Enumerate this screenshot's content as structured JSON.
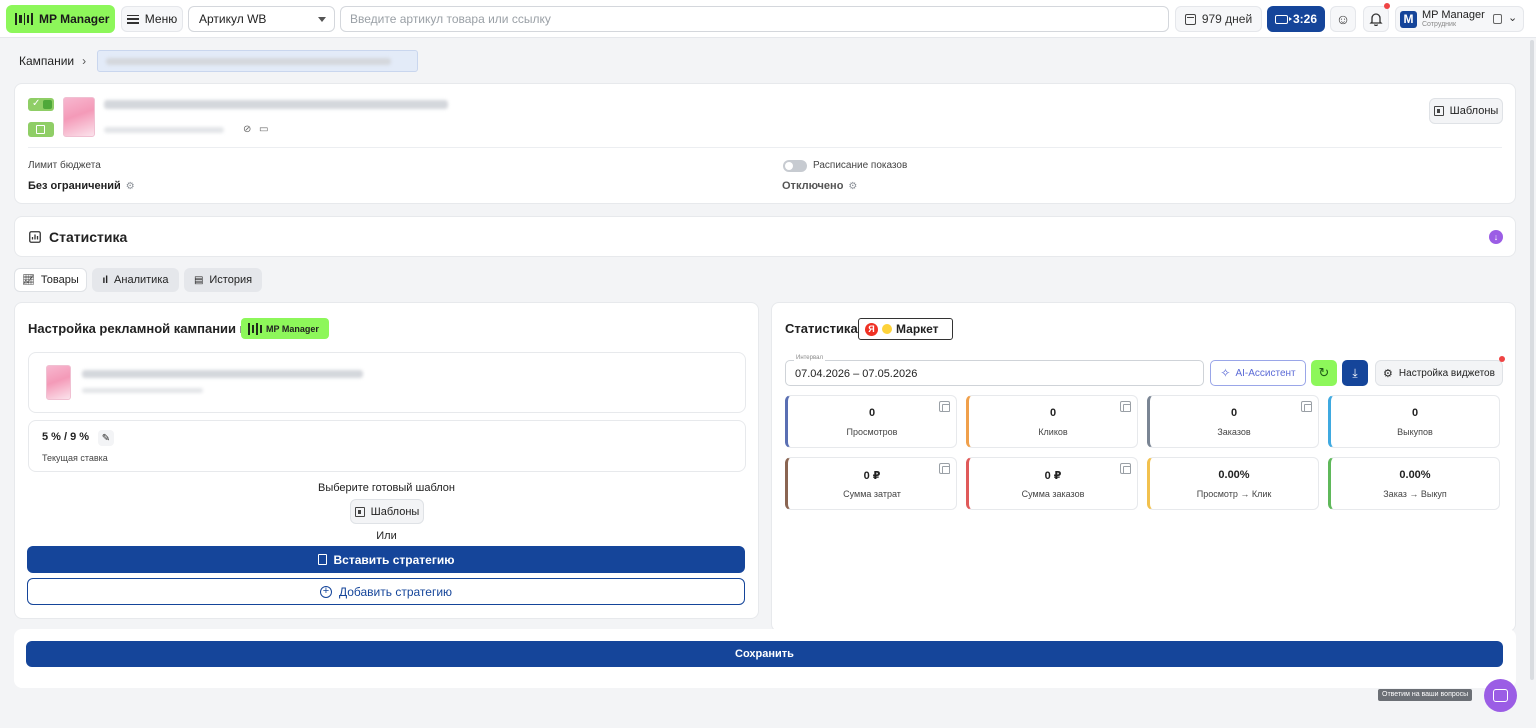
{
  "topbar": {
    "logo_label": "MP Manager",
    "menu_label": "Меню",
    "article_select": "Артикул WB",
    "search_placeholder": "Введите артикул товара или ссылку",
    "days_label": "979 дней",
    "video_label": "3:26",
    "user_name": "MP Manager",
    "user_role": "Сотрудник",
    "avatar_letter": "M"
  },
  "breadcrumb": {
    "root": "Кампании"
  },
  "campaign": {
    "templates_label": "Шаблоны",
    "budget_label": "Лимит бюджета",
    "budget_value": "Без ограничений",
    "schedule_label": "Расписание показов",
    "schedule_value": "Отключено"
  },
  "stats_section": {
    "title": "Статистика"
  },
  "tabs": [
    {
      "label": "Товары"
    },
    {
      "label": "Аналитика"
    },
    {
      "label": "История"
    }
  ],
  "setup_panel": {
    "title": "Настройка рекламной кампании в",
    "badge_label": "MP Manager",
    "rate_value": "5 % / 9 %",
    "rate_label": "Текущая ставка",
    "choose_template": "Выберите готовый шаблон",
    "templates_label": "Шаблоны",
    "or_label": "Или",
    "insert_strategy": "Вставить стратегию",
    "add_strategy": "Добавить стратегию"
  },
  "stats_panel": {
    "title": "Статистика",
    "market_label": "Маркет",
    "interval_label": "Интервал",
    "interval_value": "07.04.2026 – 07.05.2026",
    "ai_label": "AI-Ассистент",
    "widgets_label": "Настройка виджетов",
    "tiles": [
      {
        "value": "0",
        "label": "Просмотров",
        "color": "#5a6fb3"
      },
      {
        "value": "0",
        "label": "Кликов",
        "color": "#f0a04b"
      },
      {
        "value": "0",
        "label": "Заказов",
        "color": "#7a8594"
      },
      {
        "value": "0",
        "label": "Выкупов",
        "color": "#3fa9e0"
      },
      {
        "value": "0 ₽",
        "label": "Сумма затрат",
        "color": "#8a6552"
      },
      {
        "value": "0 ₽",
        "label": "Сумма заказов",
        "color": "#e05a5a"
      },
      {
        "value": "0.00%",
        "label": "Просмотр → Клик",
        "color": "#f2c14e"
      },
      {
        "value": "0.00%",
        "label": "Заказ → Выкуп",
        "color": "#5fb85a"
      }
    ]
  },
  "save_label": "Сохранить",
  "chat_hint": "Ответим на ваши вопросы",
  "colors": {
    "brand_green": "#8df75a",
    "brand_blue": "#15459a",
    "accent_purple": "#9b5de5"
  }
}
